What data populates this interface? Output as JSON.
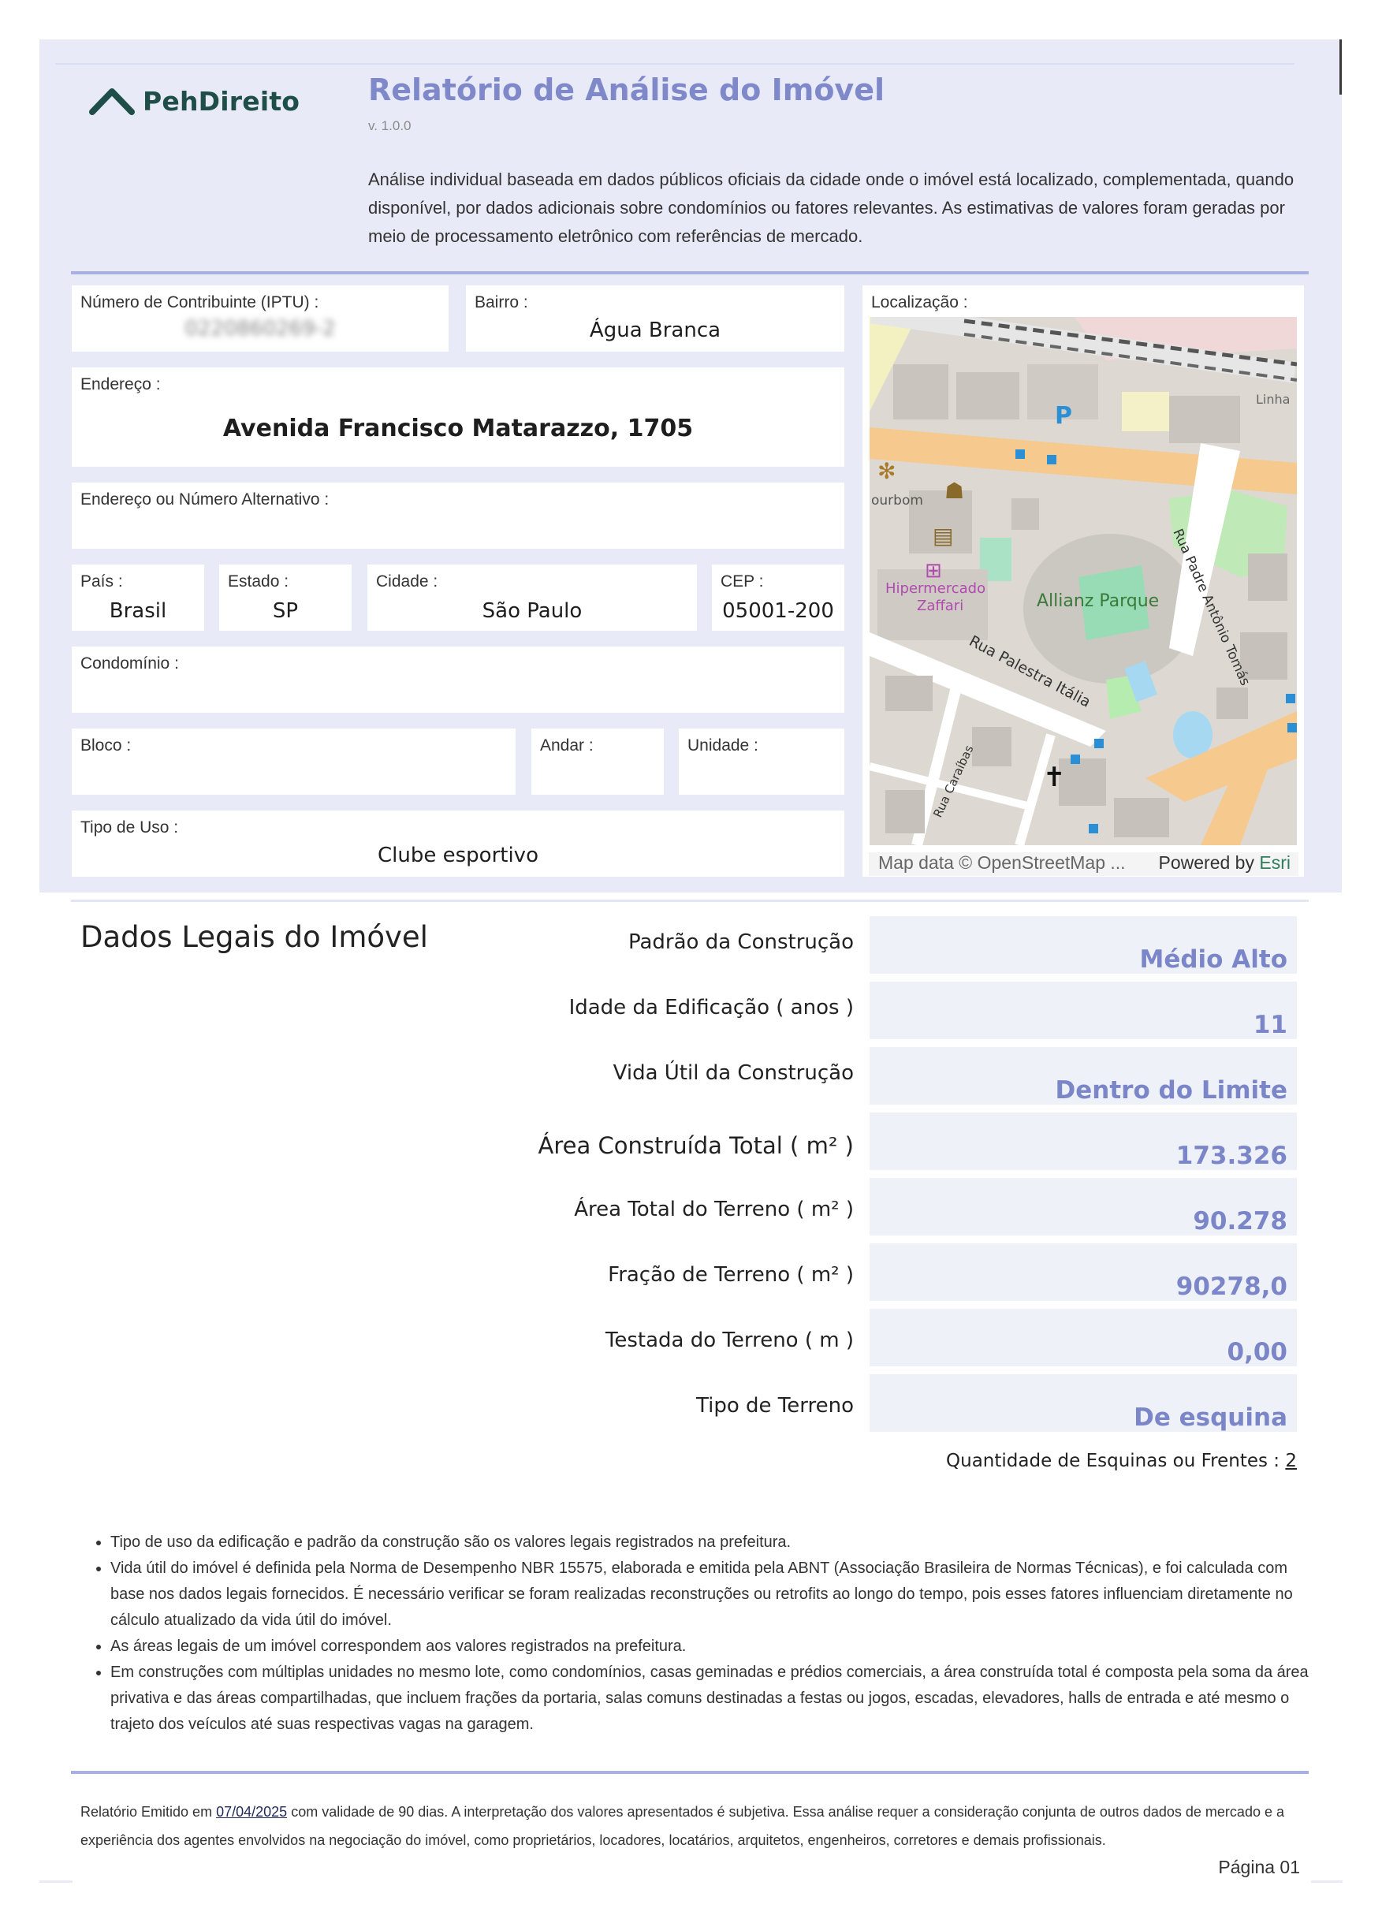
{
  "brand": {
    "name": "PehDireito",
    "color": "#1f4d48"
  },
  "header": {
    "title": "Relatório de Análise do Imóvel",
    "version": "v. 1.0.0",
    "description": "Análise individual baseada em dados públicos oficiais da cidade onde o imóvel está localizado, complementada, quando disponível, por dados adicionais sobre condomínios ou fatores relevantes. As estimativas de valores foram geradas por meio de processamento eletrônico com referências de mercado."
  },
  "fields": {
    "iptu": {
      "label": "Número de Contribuinte (IPTU) :",
      "value": "0220860269-2"
    },
    "bairro": {
      "label": "Bairro :",
      "value": "Água Branca"
    },
    "endereco": {
      "label": "Endereço :",
      "value": "Avenida Francisco Matarazzo, 1705"
    },
    "endereco_alt": {
      "label": "Endereço ou Número Alternativo :",
      "value": ""
    },
    "pais": {
      "label": "País :",
      "value": "Brasil"
    },
    "estado": {
      "label": "Estado :",
      "value": "SP"
    },
    "cidade": {
      "label": "Cidade :",
      "value": "São Paulo"
    },
    "cep": {
      "label": "CEP :",
      "value": "05001-200"
    },
    "condominio": {
      "label": "Condomínio :",
      "value": ""
    },
    "bloco": {
      "label": "Bloco :",
      "value": ""
    },
    "andar": {
      "label": "Andar :",
      "value": ""
    },
    "unidade": {
      "label": "Unidade :",
      "value": ""
    },
    "tipo_uso": {
      "label": "Tipo de Uso :",
      "value": "Clube esportivo"
    },
    "localizacao": {
      "label": "Localização :"
    }
  },
  "map": {
    "labels": {
      "allianz": "Allianz Parque",
      "hipermercado": "Hipermercado",
      "zaffari": "Zaffari",
      "palestra": "Rua Palestra Itália",
      "padre": "Rua Padre Antônio Tomás",
      "caraibas": "Rua Caraíbas",
      "bourbon": "ourbom",
      "linha": "Linha",
      "parking": "P"
    },
    "credit": "Map data © OpenStreetMap ...",
    "powered": "Powered by",
    "esri": "Esri"
  },
  "legal": {
    "title": "Dados Legais do Imóvel",
    "rows": [
      {
        "label": "Padrão da Construção",
        "value": "Médio Alto"
      },
      {
        "label": "Idade da Edificação ( anos )",
        "value": "11"
      },
      {
        "label": "Vida Útil da Construção",
        "value": "Dentro do Limite"
      },
      {
        "label": "Área Construída Total ( m² )",
        "value": "173.326"
      },
      {
        "label": "Área Total do Terreno ( m² )",
        "value": "90.278"
      },
      {
        "label": "Fração de Terreno ( m² )",
        "value": "90278,0"
      },
      {
        "label": "Testada do Terreno ( m )",
        "value": "0,00"
      },
      {
        "label": "Tipo de Terreno",
        "value": "De esquina"
      }
    ],
    "esquinas_label": "Quantidade de Esquinas ou Frentes :",
    "esquinas_value": "2"
  },
  "notes": [
    "Tipo de uso da edificação e padrão da construção são os valores legais registrados na prefeitura.",
    "Vida útil do imóvel é definida pela Norma de Desempenho NBR 15575, elaborada e emitida pela ABNT (Associação Brasileira de Normas Técnicas), e foi calculada com base nos dados legais fornecidos. É necessário verificar se foram realizadas reconstruções ou retrofits ao longo do tempo, pois esses fatores influenciam diretamente no cálculo atualizado da vida útil do imóvel.",
    "As áreas legais de um imóvel correspondem aos valores registrados na prefeitura.",
    "Em construções com múltiplas unidades no mesmo lote, como condomínios, casas geminadas e prédios comerciais, a área construída total é composta pela soma da área privativa e das áreas compartilhadas, que incluem frações da portaria, salas comuns destinadas a festas ou jogos, escadas, elevadores, halls de entrada e até mesmo o trajeto dos veículos até suas respectivas vagas na garagem."
  ],
  "footer": {
    "pre": "Relatório Emitido em",
    "date": "07/04/2025",
    "post": "com validade de 90 dias. A interpretação dos valores apresentados é subjetiva. Essa análise requer a consideração conjunta de outros dados de mercado e a experiência dos agentes envolvidos na negociação do imóvel, como proprietários, locadores, locatários, arquitetos, engenheiros, corretores e demais profissionais.",
    "page": "Página 01"
  },
  "colors": {
    "accent": "#7f89c9",
    "band": "#e8ebf7",
    "rule": "#a7b0e0"
  }
}
